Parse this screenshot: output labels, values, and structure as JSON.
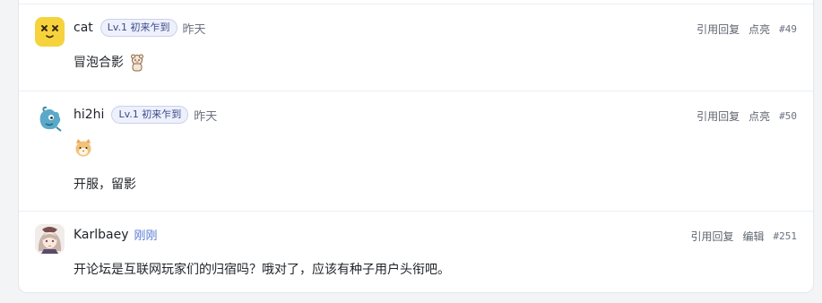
{
  "posts": [
    {
      "username": "cat",
      "badge": "Lv.1 初来乍到",
      "time": "昨天",
      "actions": [
        "引用回复",
        "点亮"
      ],
      "floor": "#49",
      "content": "冒泡合影",
      "avatar_icon": "dog-face-icon"
    },
    {
      "username": "hi2hi",
      "badge": "Lv.1 初来乍到",
      "time": "昨天",
      "actions": [
        "引用回复",
        "点亮"
      ],
      "floor": "#50",
      "content": "开服，留影",
      "avatar_icon": "blue-creature-icon"
    },
    {
      "username": "Karlbaey",
      "badge": "",
      "time": "刚刚",
      "actions": [
        "引用回复",
        "编辑"
      ],
      "floor": "#251",
      "content": "开论坛是互联网玩家们的归宿吗？哦对了，应该有种子用户头衔吧。",
      "avatar_icon": "anime-girl-icon"
    }
  ],
  "colors": {
    "badge_text": "#3b4a8c",
    "badge_bg": "#eef1fb",
    "time_recent": "#5b7bd5"
  }
}
